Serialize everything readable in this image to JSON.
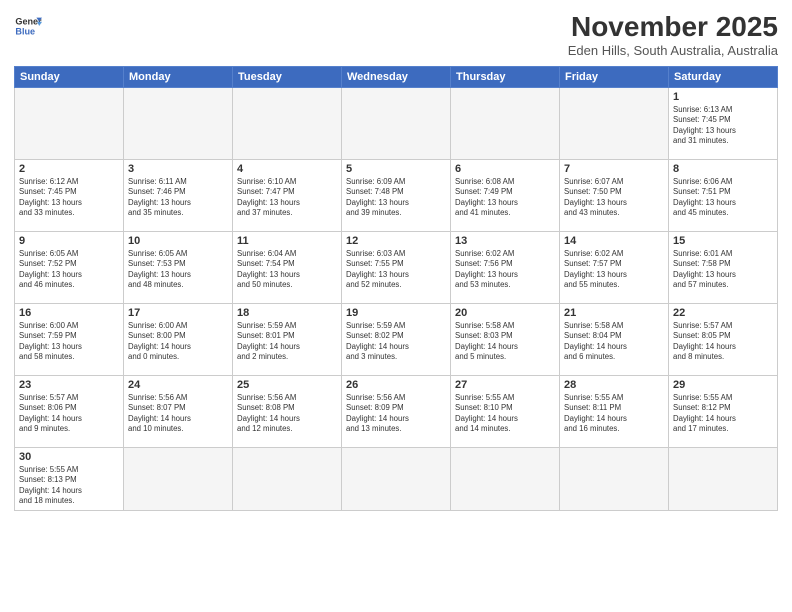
{
  "header": {
    "logo_general": "General",
    "logo_blue": "Blue",
    "month": "November 2025",
    "location": "Eden Hills, South Australia, Australia"
  },
  "weekdays": [
    "Sunday",
    "Monday",
    "Tuesday",
    "Wednesday",
    "Thursday",
    "Friday",
    "Saturday"
  ],
  "weeks": [
    [
      {
        "day": "",
        "info": ""
      },
      {
        "day": "",
        "info": ""
      },
      {
        "day": "",
        "info": ""
      },
      {
        "day": "",
        "info": ""
      },
      {
        "day": "",
        "info": ""
      },
      {
        "day": "",
        "info": ""
      },
      {
        "day": "1",
        "info": "Sunrise: 6:13 AM\nSunset: 7:45 PM\nDaylight: 13 hours\nand 31 minutes."
      }
    ],
    [
      {
        "day": "2",
        "info": "Sunrise: 6:12 AM\nSunset: 7:45 PM\nDaylight: 13 hours\nand 33 minutes."
      },
      {
        "day": "3",
        "info": "Sunrise: 6:11 AM\nSunset: 7:46 PM\nDaylight: 13 hours\nand 35 minutes."
      },
      {
        "day": "4",
        "info": "Sunrise: 6:10 AM\nSunset: 7:47 PM\nDaylight: 13 hours\nand 37 minutes."
      },
      {
        "day": "5",
        "info": "Sunrise: 6:09 AM\nSunset: 7:48 PM\nDaylight: 13 hours\nand 39 minutes."
      },
      {
        "day": "6",
        "info": "Sunrise: 6:08 AM\nSunset: 7:49 PM\nDaylight: 13 hours\nand 41 minutes."
      },
      {
        "day": "7",
        "info": "Sunrise: 6:07 AM\nSunset: 7:50 PM\nDaylight: 13 hours\nand 43 minutes."
      },
      {
        "day": "8",
        "info": "Sunrise: 6:06 AM\nSunset: 7:51 PM\nDaylight: 13 hours\nand 45 minutes."
      }
    ],
    [
      {
        "day": "9",
        "info": "Sunrise: 6:05 AM\nSunset: 7:52 PM\nDaylight: 13 hours\nand 46 minutes."
      },
      {
        "day": "10",
        "info": "Sunrise: 6:05 AM\nSunset: 7:53 PM\nDaylight: 13 hours\nand 48 minutes."
      },
      {
        "day": "11",
        "info": "Sunrise: 6:04 AM\nSunset: 7:54 PM\nDaylight: 13 hours\nand 50 minutes."
      },
      {
        "day": "12",
        "info": "Sunrise: 6:03 AM\nSunset: 7:55 PM\nDaylight: 13 hours\nand 52 minutes."
      },
      {
        "day": "13",
        "info": "Sunrise: 6:02 AM\nSunset: 7:56 PM\nDaylight: 13 hours\nand 53 minutes."
      },
      {
        "day": "14",
        "info": "Sunrise: 6:02 AM\nSunset: 7:57 PM\nDaylight: 13 hours\nand 55 minutes."
      },
      {
        "day": "15",
        "info": "Sunrise: 6:01 AM\nSunset: 7:58 PM\nDaylight: 13 hours\nand 57 minutes."
      }
    ],
    [
      {
        "day": "16",
        "info": "Sunrise: 6:00 AM\nSunset: 7:59 PM\nDaylight: 13 hours\nand 58 minutes."
      },
      {
        "day": "17",
        "info": "Sunrise: 6:00 AM\nSunset: 8:00 PM\nDaylight: 14 hours\nand 0 minutes."
      },
      {
        "day": "18",
        "info": "Sunrise: 5:59 AM\nSunset: 8:01 PM\nDaylight: 14 hours\nand 2 minutes."
      },
      {
        "day": "19",
        "info": "Sunrise: 5:59 AM\nSunset: 8:02 PM\nDaylight: 14 hours\nand 3 minutes."
      },
      {
        "day": "20",
        "info": "Sunrise: 5:58 AM\nSunset: 8:03 PM\nDaylight: 14 hours\nand 5 minutes."
      },
      {
        "day": "21",
        "info": "Sunrise: 5:58 AM\nSunset: 8:04 PM\nDaylight: 14 hours\nand 6 minutes."
      },
      {
        "day": "22",
        "info": "Sunrise: 5:57 AM\nSunset: 8:05 PM\nDaylight: 14 hours\nand 8 minutes."
      }
    ],
    [
      {
        "day": "23",
        "info": "Sunrise: 5:57 AM\nSunset: 8:06 PM\nDaylight: 14 hours\nand 9 minutes."
      },
      {
        "day": "24",
        "info": "Sunrise: 5:56 AM\nSunset: 8:07 PM\nDaylight: 14 hours\nand 10 minutes."
      },
      {
        "day": "25",
        "info": "Sunrise: 5:56 AM\nSunset: 8:08 PM\nDaylight: 14 hours\nand 12 minutes."
      },
      {
        "day": "26",
        "info": "Sunrise: 5:56 AM\nSunset: 8:09 PM\nDaylight: 14 hours\nand 13 minutes."
      },
      {
        "day": "27",
        "info": "Sunrise: 5:55 AM\nSunset: 8:10 PM\nDaylight: 14 hours\nand 14 minutes."
      },
      {
        "day": "28",
        "info": "Sunrise: 5:55 AM\nSunset: 8:11 PM\nDaylight: 14 hours\nand 16 minutes."
      },
      {
        "day": "29",
        "info": "Sunrise: 5:55 AM\nSunset: 8:12 PM\nDaylight: 14 hours\nand 17 minutes."
      }
    ],
    [
      {
        "day": "30",
        "info": "Sunrise: 5:55 AM\nSunset: 8:13 PM\nDaylight: 14 hours\nand 18 minutes."
      },
      {
        "day": "",
        "info": ""
      },
      {
        "day": "",
        "info": ""
      },
      {
        "day": "",
        "info": ""
      },
      {
        "day": "",
        "info": ""
      },
      {
        "day": "",
        "info": ""
      },
      {
        "day": "",
        "info": ""
      }
    ]
  ]
}
